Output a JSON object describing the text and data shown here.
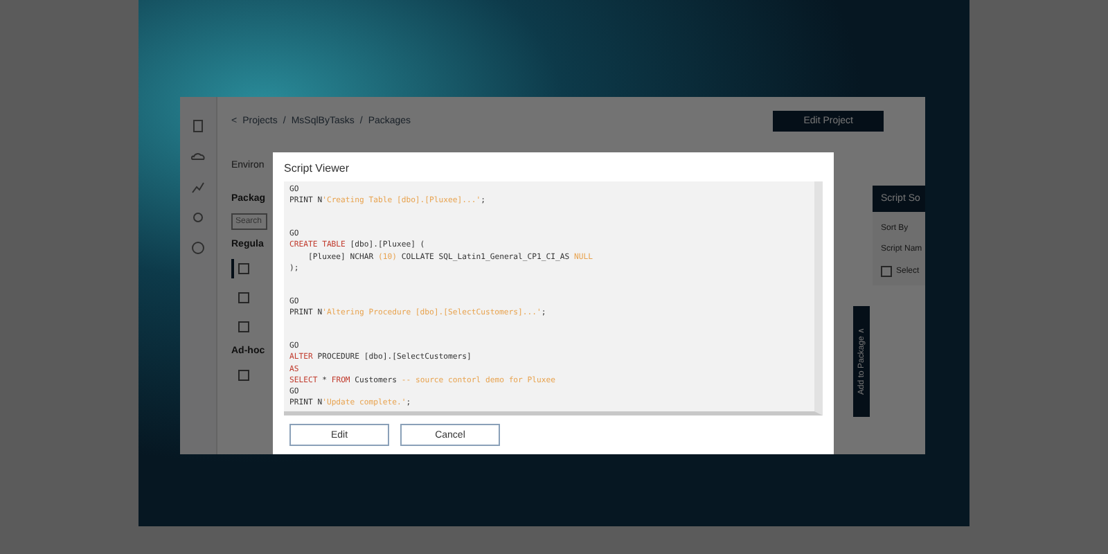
{
  "breadcrumb": {
    "back": "<",
    "items": [
      "Projects",
      "MsSqlByTasks",
      "Packages"
    ],
    "separators": [
      "/",
      "/"
    ]
  },
  "edit_project": "Edit Project",
  "tab": "Environ",
  "left_panel": {
    "title": "Packag",
    "search": {
      "placeholder": "Search"
    },
    "section": "Regula",
    "items": [
      {
        "selected": true
      },
      {
        "selected": false
      },
      {
        "selected": false
      }
    ],
    "section_2": "Ad-hoc",
    "items_2": [
      {
        "selected": false
      }
    ]
  },
  "right_panel": {
    "button": "Script So",
    "sort_by": "Sort By",
    "column": "Script Nam",
    "select": {
      "label": "Select",
      "checked": false
    },
    "add_button": "Add to Package ∧"
  },
  "modal": {
    "title": "Script Viewer",
    "buttons": [
      "Edit",
      "Cancel"
    ],
    "lines": [
      {
        "kind": "code",
        "tokens": [
          {
            "kind": "plain",
            "text": "GO"
          }
        ]
      },
      {
        "kind": "code",
        "tokens": [
          {
            "kind": "plain",
            "text": "PRINT N"
          },
          {
            "kind": "string",
            "text": "'Creating Table [dbo].[Pluxee]...'"
          },
          {
            "kind": "plain",
            "text": ";"
          }
        ]
      },
      {
        "kind": "blank"
      },
      {
        "kind": "blank"
      },
      {
        "kind": "code",
        "tokens": [
          {
            "kind": "plain",
            "text": "GO"
          }
        ]
      },
      {
        "kind": "code",
        "tokens": [
          {
            "kind": "keyword",
            "text": "CREATE TABLE"
          },
          {
            "kind": "plain",
            "text": " [dbo].[Pluxee] ("
          }
        ]
      },
      {
        "kind": "code",
        "tokens": [
          {
            "kind": "plain",
            "text": "    [Pluxee] NCHAR "
          },
          {
            "kind": "string",
            "text": "(10)"
          },
          {
            "kind": "plain",
            "text": " COLLATE SQL_Latin1_General_CP1_CI_AS "
          },
          {
            "kind": "string",
            "text": "NULL"
          }
        ]
      },
      {
        "kind": "code",
        "tokens": [
          {
            "kind": "plain",
            "text": ");"
          }
        ]
      },
      {
        "kind": "blank"
      },
      {
        "kind": "blank"
      },
      {
        "kind": "code",
        "tokens": [
          {
            "kind": "plain",
            "text": "GO"
          }
        ]
      },
      {
        "kind": "code",
        "tokens": [
          {
            "kind": "plain",
            "text": "PRINT N"
          },
          {
            "kind": "string",
            "text": "'Altering Procedure [dbo].[SelectCustomers]...'"
          },
          {
            "kind": "plain",
            "text": ";"
          }
        ]
      },
      {
        "kind": "blank"
      },
      {
        "kind": "blank"
      },
      {
        "kind": "code",
        "tokens": [
          {
            "kind": "plain",
            "text": "GO"
          }
        ]
      },
      {
        "kind": "code",
        "tokens": [
          {
            "kind": "keyword",
            "text": "ALTER"
          },
          {
            "kind": "plain",
            "text": " PROCEDURE [dbo].[SelectCustomers]"
          }
        ]
      },
      {
        "kind": "code",
        "tokens": [
          {
            "kind": "keyword",
            "text": "AS"
          }
        ]
      },
      {
        "kind": "code",
        "tokens": [
          {
            "kind": "keyword",
            "text": "SELECT"
          },
          {
            "kind": "plain",
            "text": " * "
          },
          {
            "kind": "keyword",
            "text": "FROM"
          },
          {
            "kind": "plain",
            "text": " Customers "
          },
          {
            "kind": "string",
            "text": "-- source contorl demo for Pluxee"
          }
        ]
      },
      {
        "kind": "code",
        "tokens": [
          {
            "kind": "plain",
            "text": "GO"
          }
        ]
      },
      {
        "kind": "code",
        "tokens": [
          {
            "kind": "plain",
            "text": "PRINT N"
          },
          {
            "kind": "string",
            "text": "'Update complete.'"
          },
          {
            "kind": "plain",
            "text": ";"
          }
        ]
      }
    ]
  }
}
